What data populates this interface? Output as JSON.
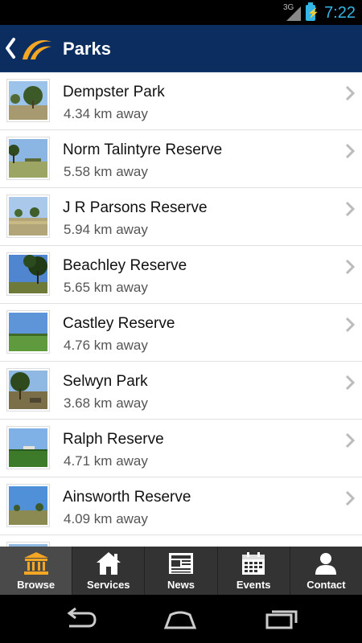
{
  "status": {
    "network": "3G",
    "time": "7:22"
  },
  "header": {
    "title": "Parks"
  },
  "parks": [
    {
      "name": "Dempster Park",
      "distance": "4.34 km away"
    },
    {
      "name": "Norm Talintyre Reserve",
      "distance": "5.58 km away"
    },
    {
      "name": "J R Parsons Reserve",
      "distance": "5.94 km away"
    },
    {
      "name": "Beachley Reserve",
      "distance": "5.65 km away"
    },
    {
      "name": "Castley Reserve",
      "distance": "4.76 km away"
    },
    {
      "name": "Selwyn Park",
      "distance": "3.68 km away"
    },
    {
      "name": "Ralph Reserve",
      "distance": "4.71 km away"
    },
    {
      "name": "Ainsworth Reserve",
      "distance": "4.09 km away"
    }
  ],
  "tabs": [
    {
      "label": "Browse",
      "icon": "browse-icon"
    },
    {
      "label": "Services",
      "icon": "services-icon"
    },
    {
      "label": "News",
      "icon": "news-icon"
    },
    {
      "label": "Events",
      "icon": "events-icon"
    },
    {
      "label": "Contact",
      "icon": "contact-icon"
    }
  ],
  "colors": {
    "appbar": "#0b2d5f",
    "accent": "#33b5e5",
    "logo": "#f5a623"
  }
}
